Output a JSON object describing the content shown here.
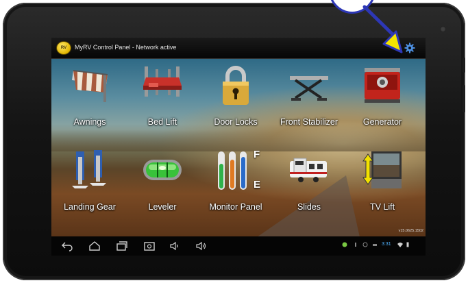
{
  "app": {
    "title": "MyRV Control Panel - Network active",
    "logo_text": "RV"
  },
  "tiles": [
    {
      "label": "Awnings"
    },
    {
      "label": "Bed Lift"
    },
    {
      "label": "Door Locks"
    },
    {
      "label": "Front Stabilizer"
    },
    {
      "label": "Generator"
    },
    {
      "label": "Landing Gear"
    },
    {
      "label": "Leveler"
    },
    {
      "label": "Monitor Panel"
    },
    {
      "label": "Slides"
    },
    {
      "label": "TV Lift"
    }
  ],
  "monitor_panel": {
    "full_label": "F",
    "empty_label": "E"
  },
  "version": "v15.0625.1502",
  "status": {
    "time": "3:31"
  },
  "nav_icons": [
    "back-icon",
    "home-icon",
    "recent-apps-icon",
    "screenshot-icon",
    "volume-down-icon",
    "volume-up-icon"
  ],
  "colors": {
    "annotation": "#2d37b6",
    "arrow_tip": "#f4e400",
    "gear": "#4d8fe0"
  }
}
